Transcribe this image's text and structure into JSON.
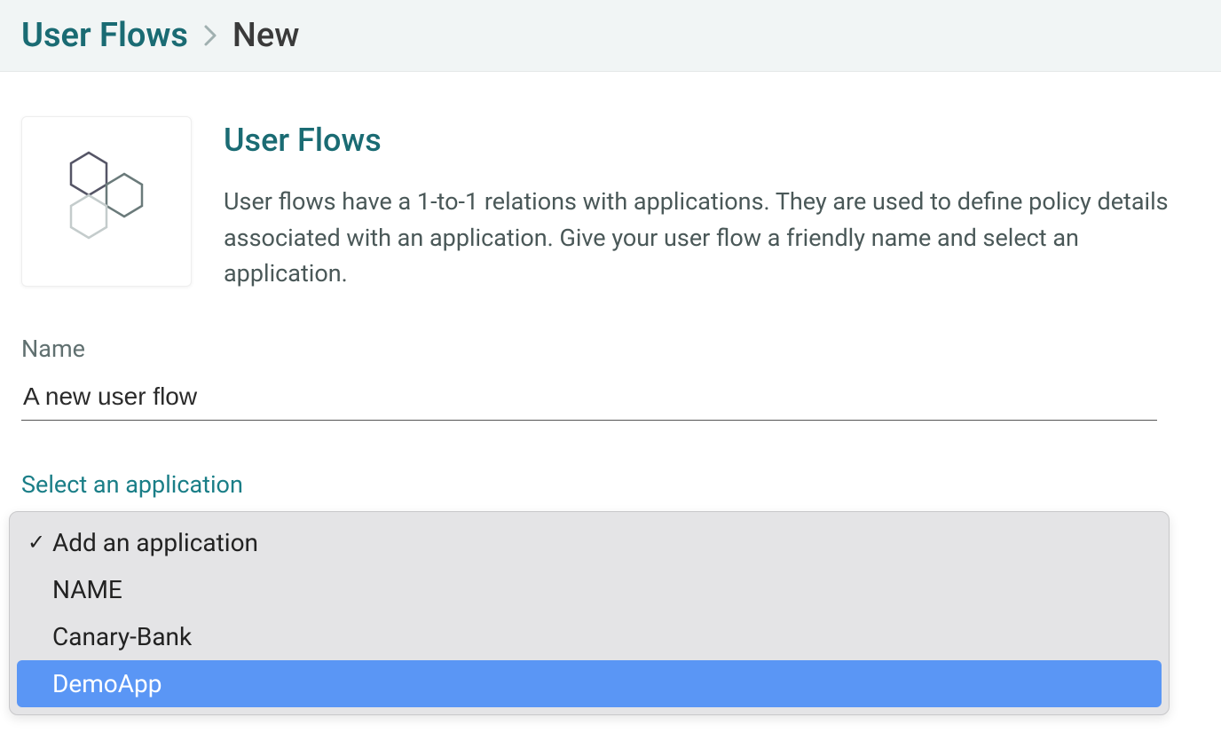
{
  "breadcrumb": {
    "parent": "User Flows",
    "current": "New"
  },
  "intro": {
    "title": "User Flows",
    "description": "User flows have a 1-to-1 relations with applications. They are used to define policy details associated with an application. Give your user flow a friendly name and select an application."
  },
  "form": {
    "nameLabel": "Name",
    "nameValue": "A new user flow",
    "selectLabel": "Select an application"
  },
  "dropdown": {
    "options": [
      {
        "label": "Add an application",
        "checked": true,
        "highlight": false
      },
      {
        "label": "NAME",
        "checked": false,
        "highlight": false
      },
      {
        "label": "Canary-Bank",
        "checked": false,
        "highlight": false
      },
      {
        "label": "DemoApp",
        "checked": false,
        "highlight": true
      }
    ]
  }
}
